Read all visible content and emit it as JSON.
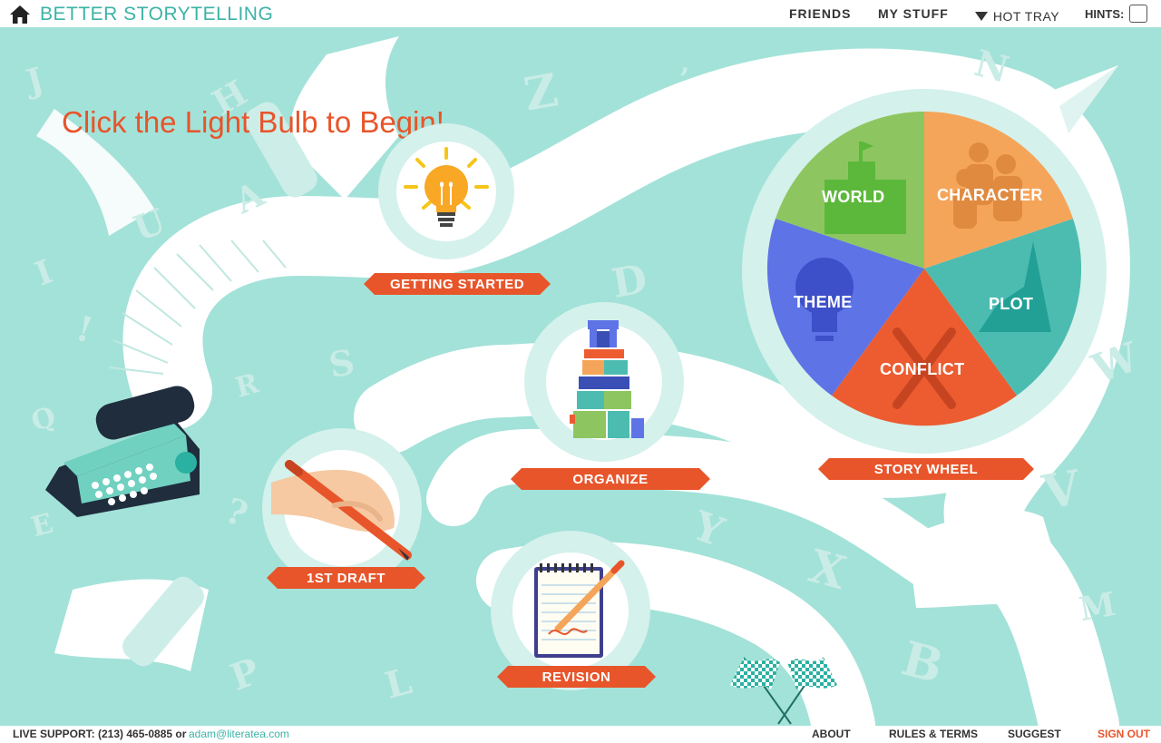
{
  "header": {
    "title": "BETTER STORYTELLING",
    "nav": {
      "friends": "FRIENDS",
      "my_stuff": "MY STUFF",
      "hot_tray": "HOT TRAY",
      "hints": "HINTS:"
    }
  },
  "main": {
    "headline": "Click the Light Bulb to Begin!",
    "steps": {
      "getting_started": "GETTING STARTED",
      "organize": "ORGANIZE",
      "first_draft": "1ST DRAFT",
      "revision": "REVISION",
      "story_wheel": "STORY WHEEL"
    },
    "wheel": {
      "world": "WORLD",
      "character": "CHARACTER",
      "plot": "PLOT",
      "conflict": "CONFLICT",
      "theme": "THEME"
    },
    "colors": {
      "accent": "#e8552a",
      "brand": "#3bb3a6",
      "background": "#a3e2d8",
      "world": "#8dc660",
      "character": "#f5a55a",
      "plot": "#4cbcb1",
      "conflict": "#ec5c30",
      "theme": "#5d73e6"
    },
    "letters": [
      "J",
      "H",
      "A",
      "U",
      "I",
      "!",
      "Q",
      "E",
      "R",
      "S",
      "?",
      "Z",
      "D",
      "Y",
      "X",
      "P",
      "L",
      "B",
      "M",
      "N",
      "V",
      "W"
    ]
  },
  "footer": {
    "support_label": "LIVE SUPPORT: (213) 465-0885 or",
    "email": "adam@literatea.com",
    "about": "ABOUT",
    "rules": "RULES & TERMS",
    "suggest": "SUGGEST",
    "sign_out": "SIGN OUT"
  }
}
